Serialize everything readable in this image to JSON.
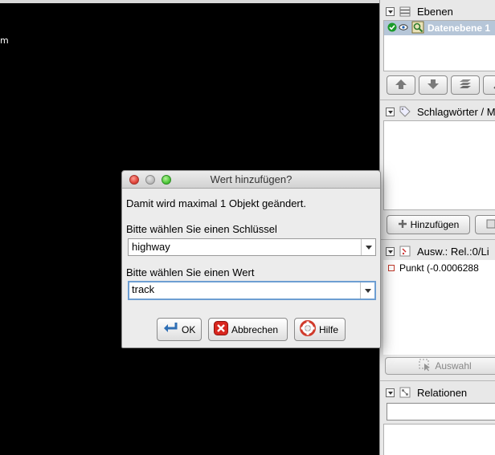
{
  "map": {
    "scale_text": "m"
  },
  "layers_panel": {
    "title": "Ebenen",
    "layer_name": "Datenebene 1"
  },
  "tags_panel": {
    "title": "Schlagwörter / M",
    "add_button": "Hinzufügen"
  },
  "selection_panel": {
    "title": "Ausw.: Rel.:0/Li",
    "item": "Punkt (-0.0006288",
    "select_button": "Auswahl"
  },
  "relations_panel": {
    "title": "Relationen"
  },
  "dialog": {
    "title": "Wert hinzufügen?",
    "message": "Damit wird maximal 1 Objekt geändert.",
    "key_label": "Bitte wählen Sie einen Schlüssel",
    "key_value": "highway",
    "value_label": "Bitte wählen Sie einen Wert",
    "value_value": "track",
    "ok_label": "OK",
    "cancel_label": "Abbrechen",
    "help_label": "Hilfe"
  },
  "colors": {
    "map_background": "#000000",
    "selected_layer": "#b6c6d8",
    "focus_ring": "#6d9ed2"
  }
}
